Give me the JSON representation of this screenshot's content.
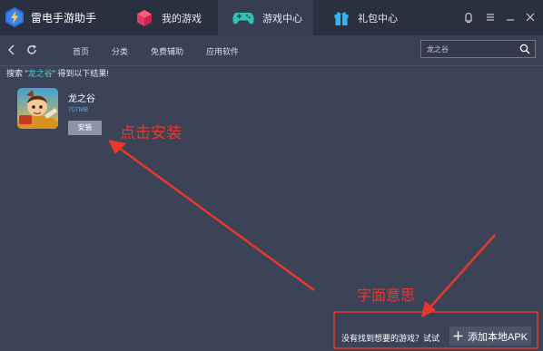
{
  "app": {
    "name": "雷电手游助手",
    "tabs": [
      {
        "label": "我的游戏",
        "icon": "cube-icon"
      },
      {
        "label": "游戏中心",
        "icon": "gamepad-icon",
        "active": true
      },
      {
        "label": "礼包中心",
        "icon": "gift-icon"
      }
    ],
    "window_controls": [
      "skin-icon",
      "menu-icon",
      "minimize-icon",
      "close-icon"
    ]
  },
  "nav": {
    "links": [
      "首页",
      "分类",
      "免费辅助",
      "应用软件"
    ],
    "search_value": "龙之谷"
  },
  "results": {
    "prefix": "搜索 \"",
    "keyword": "龙之谷",
    "suffix": "\" 得到以下结果!",
    "items": [
      {
        "name": "龙之谷",
        "size": "707MB",
        "button": "安装"
      }
    ]
  },
  "annotations": {
    "click_install": "点击安装",
    "literal_meaning": "字面意思"
  },
  "footer": {
    "prompt": "没有找到想要的游戏？试试",
    "add_apk_label": "添加本地APK"
  },
  "colors": {
    "titlebar": "#2b3040",
    "background": "#3c4357",
    "accent_teal": "#4fd0d5",
    "annotation_red": "#e8382c"
  }
}
